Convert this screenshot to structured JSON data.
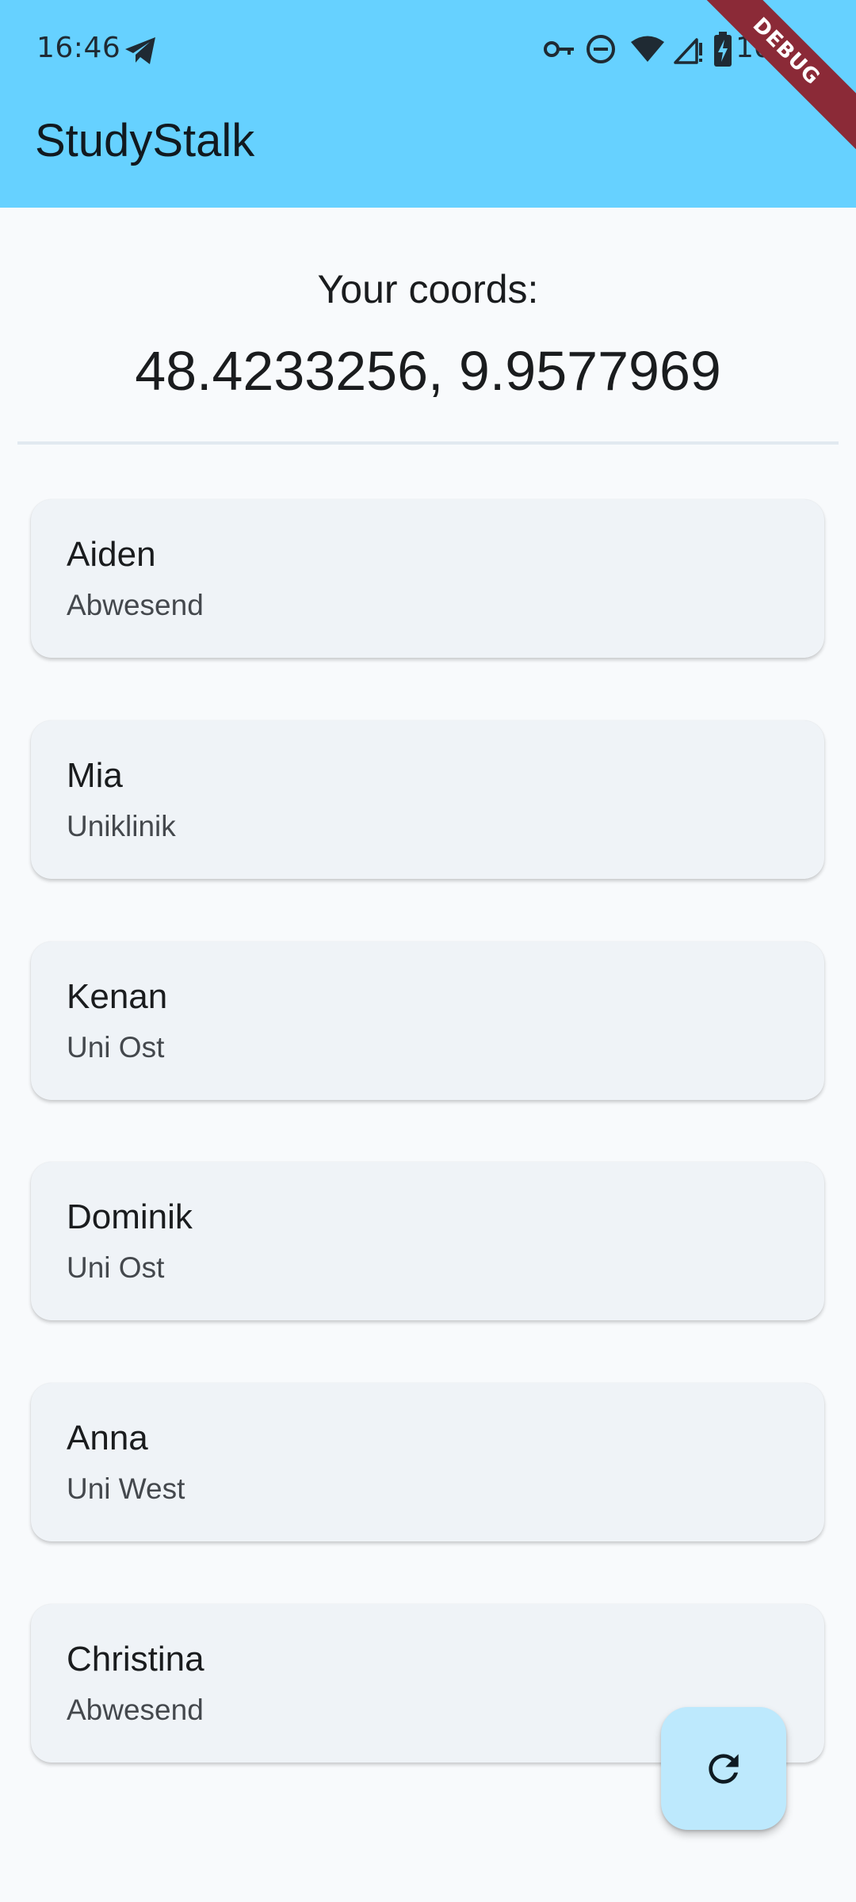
{
  "status_bar": {
    "time": "16:46",
    "battery_level": "100",
    "icons": [
      "telegram-icon",
      "vpn-key-icon",
      "do-not-disturb-icon",
      "wifi-icon",
      "signal-icon",
      "battery-charging-icon"
    ]
  },
  "app_bar": {
    "title": "StudyStalk",
    "background_color": "#66d1ff"
  },
  "debug_banner": {
    "label": "DEBUG",
    "color": "#8b2a37"
  },
  "coords": {
    "label": "Your coords:",
    "value": "48.4233256, 9.9577969"
  },
  "users": [
    {
      "name": "Aiden",
      "location": "Abwesend"
    },
    {
      "name": "Mia",
      "location": "Uniklinik"
    },
    {
      "name": "Kenan",
      "location": "Uni Ost"
    },
    {
      "name": "Dominik",
      "location": "Uni Ost"
    },
    {
      "name": "Anna",
      "location": "Uni West"
    },
    {
      "name": "Christina",
      "location": "Abwesend"
    }
  ],
  "fab": {
    "icon": "refresh-icon",
    "color": "#bde9fd"
  }
}
